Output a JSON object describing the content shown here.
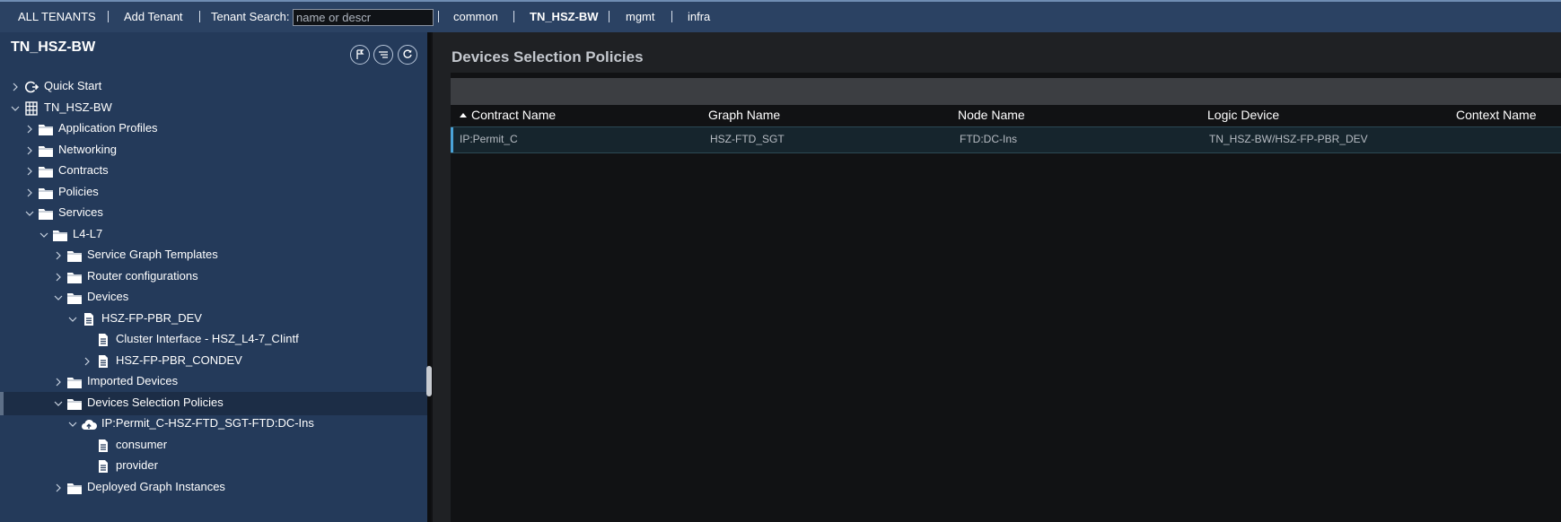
{
  "topbar": {
    "all_tenants": "ALL TENANTS",
    "add_tenant": "Add Tenant",
    "search_label": "Tenant Search:",
    "search_placeholder": "name or descr",
    "tabs": [
      "common",
      "TN_HSZ-BW",
      "mgmt",
      "infra"
    ],
    "active_tab": "TN_HSZ-BW"
  },
  "sidebar": {
    "title": "TN_HSZ-BW",
    "tree": [
      {
        "label": "Quick Start",
        "icon": "quick-start-icon",
        "expand": "collapsed"
      },
      {
        "label": "TN_HSZ-BW",
        "icon": "tenant-grid-icon",
        "expand": "expanded"
      },
      {
        "label": "Application Profiles",
        "icon": "folder-icon",
        "expand": "collapsed"
      },
      {
        "label": "Networking",
        "icon": "folder-icon",
        "expand": "collapsed"
      },
      {
        "label": "Contracts",
        "icon": "folder-icon",
        "expand": "collapsed"
      },
      {
        "label": "Policies",
        "icon": "folder-icon",
        "expand": "collapsed"
      },
      {
        "label": "Services",
        "icon": "folder-icon",
        "expand": "expanded"
      },
      {
        "label": "L4-L7",
        "icon": "folder-icon",
        "expand": "expanded"
      },
      {
        "label": "Service Graph Templates",
        "icon": "folder-icon",
        "expand": "collapsed"
      },
      {
        "label": "Router configurations",
        "icon": "folder-icon",
        "expand": "collapsed"
      },
      {
        "label": "Devices",
        "icon": "folder-icon",
        "expand": "expanded"
      },
      {
        "label": "HSZ-FP-PBR_DEV",
        "icon": "document-icon",
        "expand": "expanded"
      },
      {
        "label": "Cluster Interface - HSZ_L4-7_CIintf",
        "icon": "document-icon",
        "expand": "none"
      },
      {
        "label": "HSZ-FP-PBR_CONDEV",
        "icon": "document-icon",
        "expand": "collapsed"
      },
      {
        "label": "Imported Devices",
        "icon": "folder-icon",
        "expand": "collapsed"
      },
      {
        "label": "Devices Selection Policies",
        "icon": "folder-icon",
        "expand": "expanded"
      },
      {
        "label": "IP:Permit_C-HSZ-FTD_SGT-FTD:DC-Ins",
        "icon": "cloud-upload-icon",
        "expand": "expanded"
      },
      {
        "label": "consumer",
        "icon": "document-icon",
        "expand": "none"
      },
      {
        "label": "provider",
        "icon": "document-icon",
        "expand": "none"
      },
      {
        "label": "Deployed Graph Instances",
        "icon": "folder-icon",
        "expand": "collapsed"
      }
    ],
    "selected_item": "Devices Selection Policies"
  },
  "main": {
    "title": "Devices Selection Policies",
    "columns": [
      "Contract Name",
      "Graph Name",
      "Node Name",
      "Logic Device",
      "Context Name"
    ],
    "sorted_column": "Contract Name",
    "rows": [
      [
        "IP:Permit_C",
        "HSZ-FTD_SGT",
        "FTD:DC-Ins",
        "TN_HSZ-BW/HSZ-FP-PBR_DEV",
        ""
      ]
    ]
  },
  "colors": {
    "topbar": "#2b4263",
    "sidebar": "#243a5a",
    "content": "#111214",
    "accent": "#4aa3d8"
  }
}
